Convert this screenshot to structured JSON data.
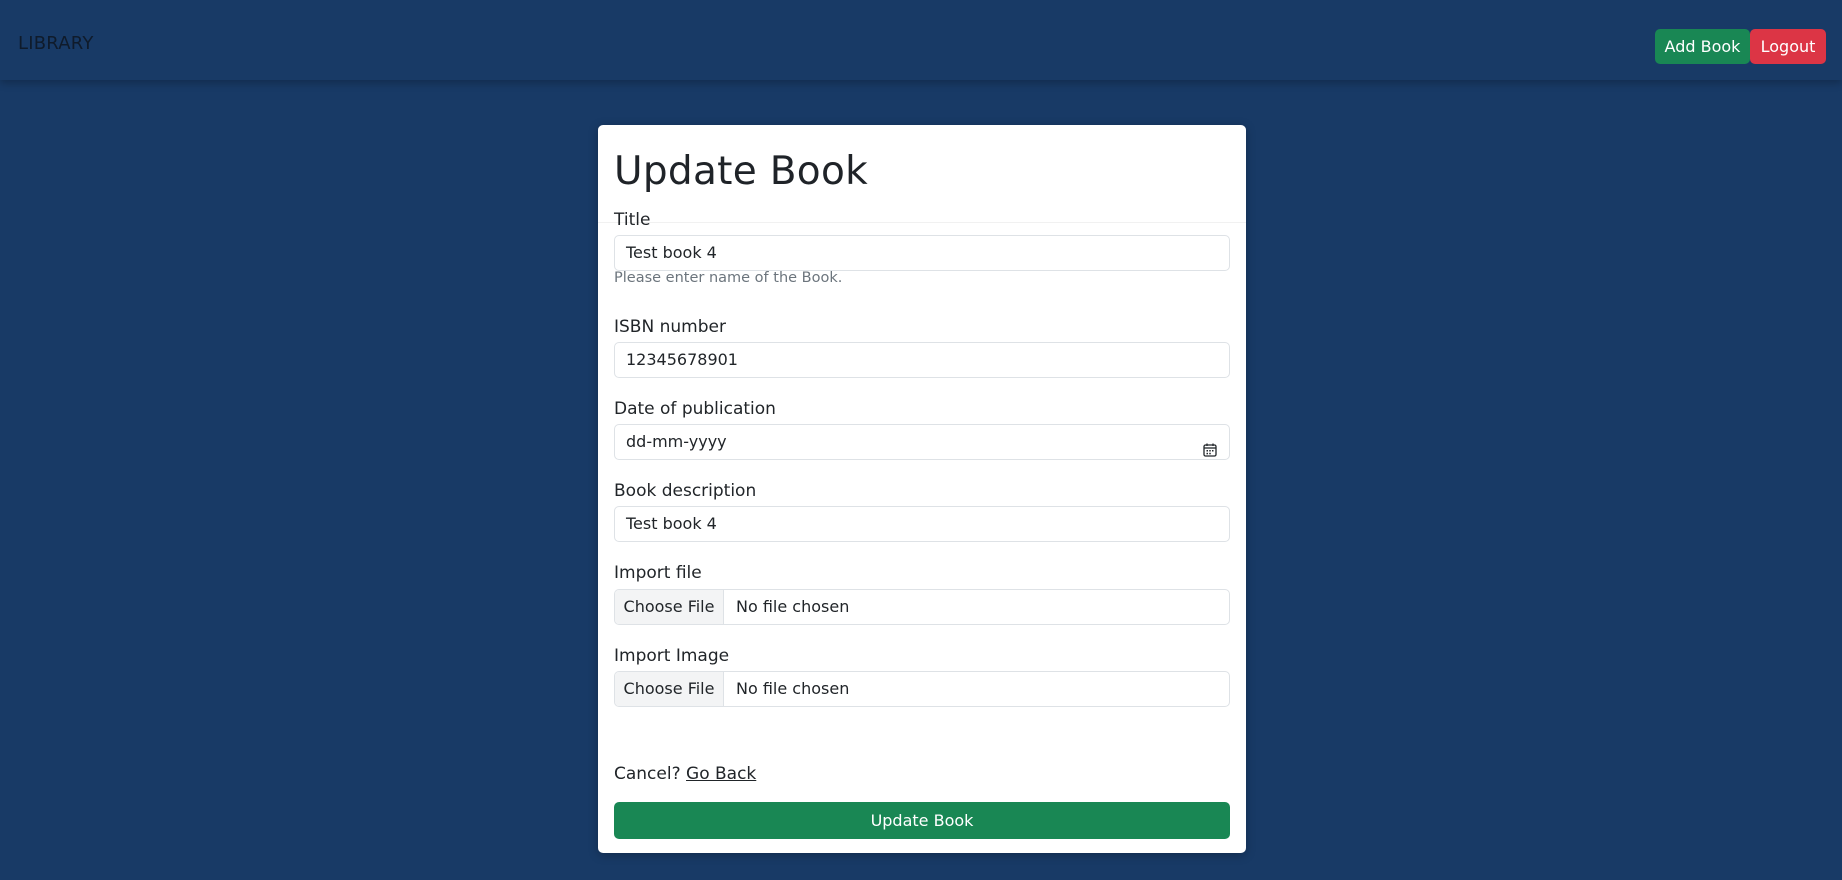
{
  "navbar": {
    "brand": "LIBRARY",
    "add_book_label": "Add Book",
    "logout_label": "Logout"
  },
  "form": {
    "title": "Update Book",
    "fields": {
      "title": {
        "label": "Title",
        "value": "Test book 4",
        "help": "Please enter name of the Book."
      },
      "isbn": {
        "label": "ISBN number",
        "value": "12345678901"
      },
      "date": {
        "label": "Date of publication",
        "placeholder": "dd-mm-yyyy"
      },
      "description": {
        "label": "Book description",
        "value": "Test book 4"
      },
      "import_file": {
        "label": "Import file",
        "button": "Choose File",
        "status": "No file chosen"
      },
      "import_image": {
        "label": "Import Image",
        "button": "Choose File",
        "status": "No file chosen"
      }
    },
    "cancel_text": "Cancel?",
    "go_back_label": "Go Back",
    "submit_label": "Update Book"
  },
  "colors": {
    "background": "#183a66",
    "success": "#198754",
    "danger": "#dc3545"
  },
  "icons": {
    "date_picker": "calendar-icon"
  }
}
